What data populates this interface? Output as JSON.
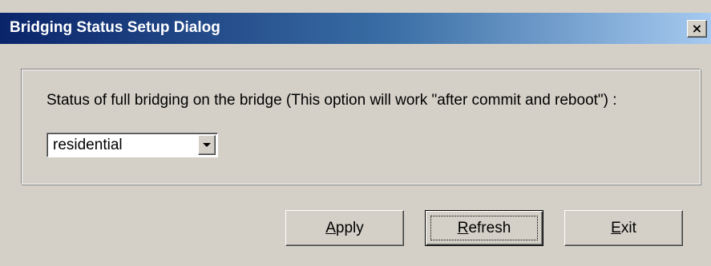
{
  "dialog": {
    "title": "Bridging Status Setup Dialog",
    "close_glyph": "×"
  },
  "status": {
    "label": "Status of full bridging on the bridge (This option will work \"after commit and reboot\") :",
    "selected": "residential"
  },
  "buttons": {
    "apply": {
      "mnemonic": "A",
      "rest": "pply"
    },
    "refresh": {
      "mnemonic": "R",
      "rest": "efresh"
    },
    "exit": {
      "mnemonic": "E",
      "rest": "xit"
    }
  },
  "colors": {
    "title_start": "#0a246a",
    "title_end": "#a6caf0",
    "face": "#d4d0c8"
  }
}
